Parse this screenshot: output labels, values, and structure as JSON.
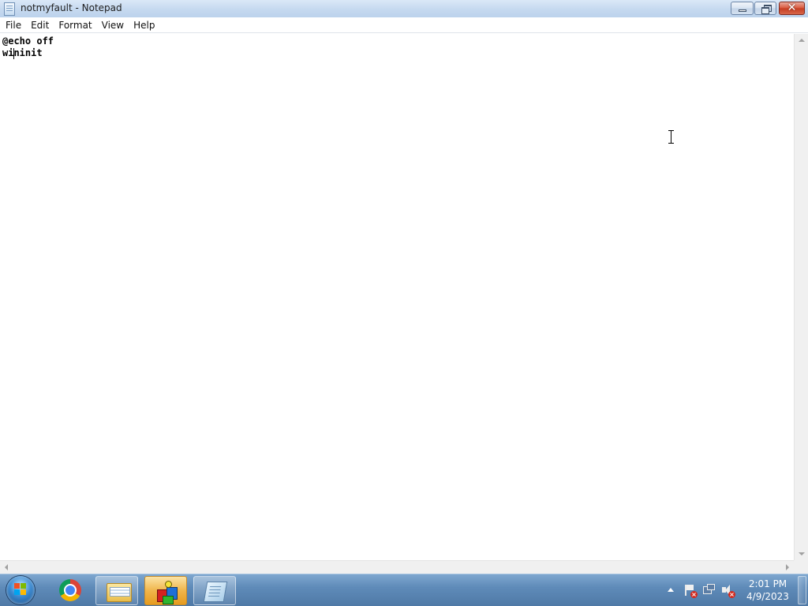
{
  "window": {
    "title": "notmyfault - Notepad",
    "close_glyph": "✕"
  },
  "menu": {
    "items": [
      "File",
      "Edit",
      "Format",
      "View",
      "Help"
    ]
  },
  "editor": {
    "lines": [
      "@echo off",
      "wininit"
    ]
  },
  "taskbar": {
    "pinned": [
      "chrome-icon",
      "explorer-folder-icon",
      "3d-cubes-app-icon",
      "notepad-icon"
    ],
    "tray": {
      "time": "2:01 PM",
      "date": "4/9/2023",
      "badge_glyph": "×"
    }
  },
  "colors": {
    "titlebar": "#c7daf0",
    "close_button": "#c53d23",
    "taskbar": "#5f8bb9",
    "active_task": "#f0b54b"
  }
}
